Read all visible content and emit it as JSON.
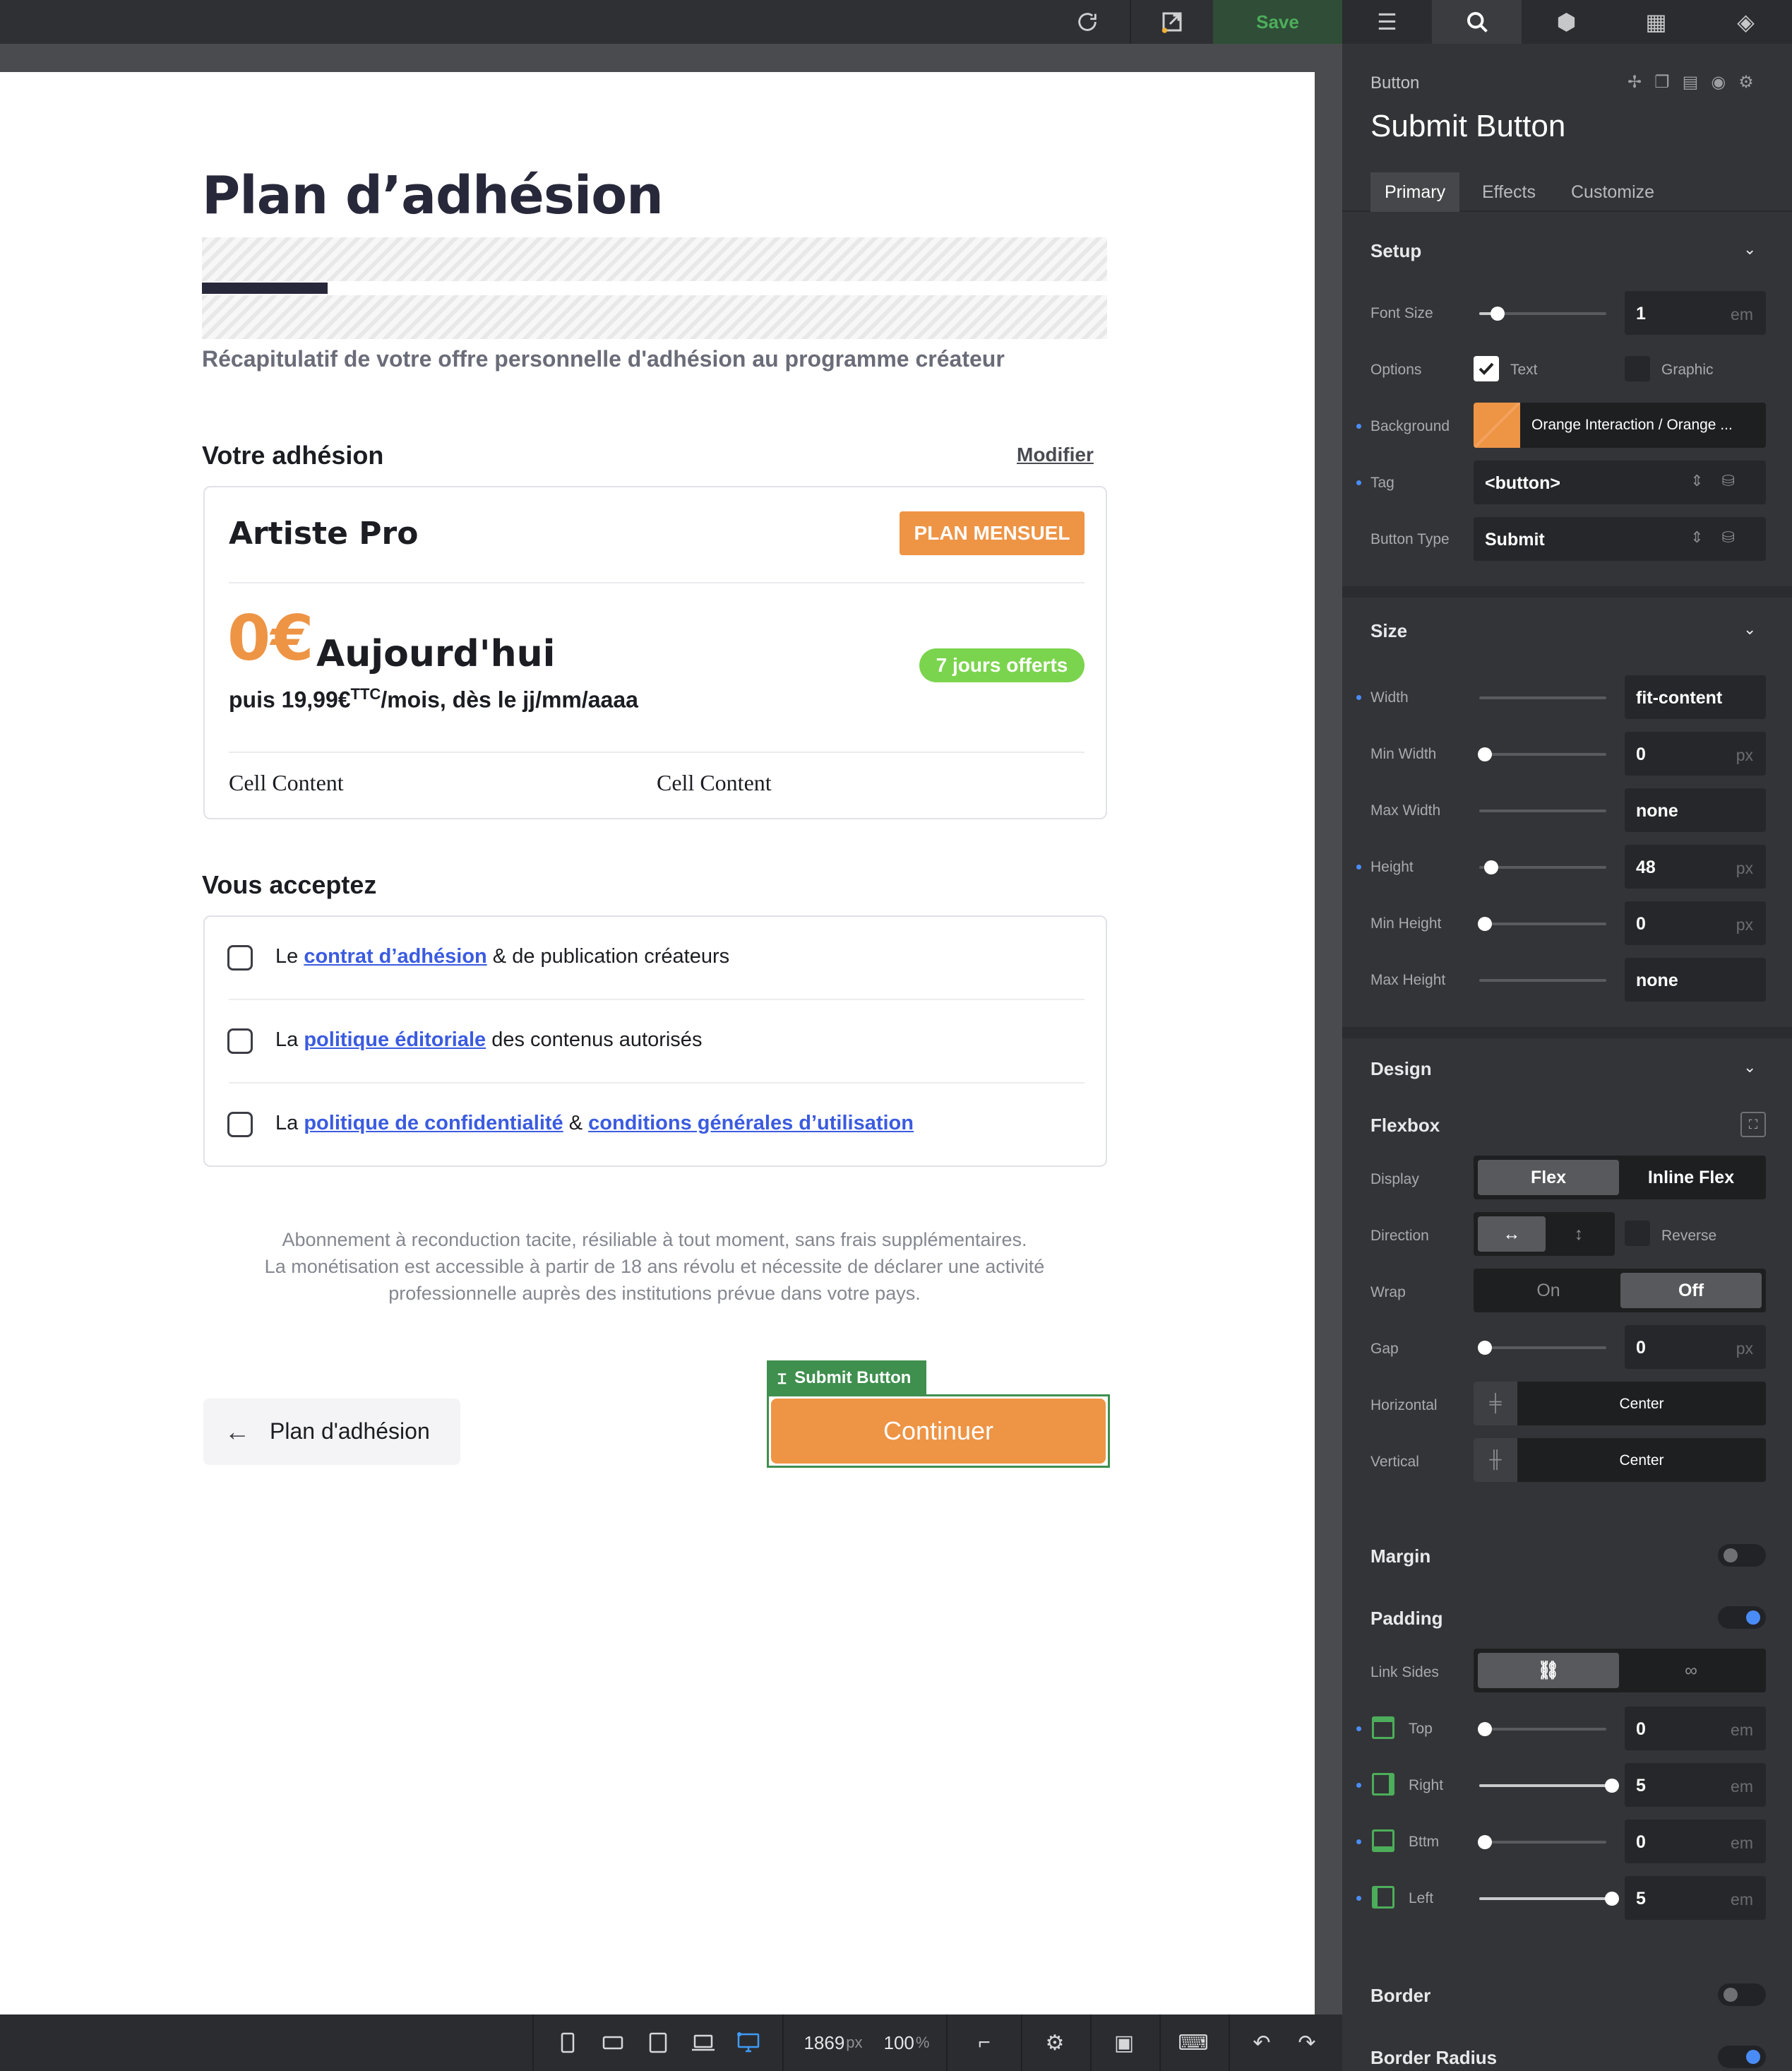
{
  "topbar": {
    "refresh_icon": "refresh-icon",
    "export_icon": "export-icon",
    "save_label": "Save"
  },
  "page": {
    "title": "Plan d’adhésion",
    "subtitle": "Récapitulatif de votre offre personnelle d'adhésion au programme créateur",
    "membership_heading": "Votre adhésion",
    "modify_link": "Modifier",
    "plan": {
      "name": "Artiste Pro",
      "badge": "PLAN MENSUEL",
      "price": "0€",
      "price_label": "Aujourd'hui",
      "price_sub_prefix": "puis 19,99€",
      "price_sub_sup": "TTC",
      "price_sub_suffix": "/mois, dès le jj/mm/aaaa",
      "offer_badge": "7 jours offerts",
      "cells": [
        "Cell Content",
        "Cell Content"
      ]
    },
    "accept_heading": "Vous acceptez",
    "terms": [
      {
        "pre": "Le ",
        "link1": "contrat d’adhésion",
        "mid": " & de publication créateurs",
        "link2": "",
        "post": ""
      },
      {
        "pre": "La ",
        "link1": "politique éditoriale",
        "mid": " des contenus autorisés",
        "link2": "",
        "post": ""
      },
      {
        "pre": "La ",
        "link1": "politique de confidentialité",
        "mid": " & ",
        "link2": "conditions générales d’utilisation",
        "post": ""
      }
    ],
    "legal": [
      "Abonnement à reconduction tacite, résiliable à tout moment, sans frais supplémentaires.",
      "La monétisation est accessible à partir de 18 ans révolu et nécessite de déclarer une activité",
      "professionnelle auprès des institutions prévue dans votre pays."
    ],
    "back_button": "Plan d'adhésion",
    "selection_tag": "Submit Button",
    "continue_button": "Continuer"
  },
  "bottombar": {
    "width_value": "1869",
    "width_unit": "px",
    "zoom_value": "100",
    "zoom_unit": "%"
  },
  "panel": {
    "element_type": "Button",
    "element_name": "Submit Button",
    "subtabs": [
      "Primary",
      "Effects",
      "Customize"
    ],
    "setup": {
      "heading": "Setup",
      "font_size_label": "Font Size",
      "font_size_value": "1",
      "font_size_unit": "em",
      "font_size_level": 0.1,
      "options_label": "Options",
      "option_text": "Text",
      "option_graphic": "Graphic",
      "option_text_checked": true,
      "option_graphic_checked": false,
      "background_label": "Background",
      "background_value": "Orange Interaction / Orange ...",
      "background_color": "#ee9445",
      "tag_label": "Tag",
      "tag_value": "<button>",
      "button_type_label": "Button Type",
      "button_type_value": "Submit"
    },
    "size": {
      "heading": "Size",
      "rows": [
        {
          "label": "Width",
          "value": "fit-content",
          "unit": "",
          "slider": false,
          "level": 0,
          "dot": true
        },
        {
          "label": "Min Width",
          "value": "0",
          "unit": "px",
          "slider": true,
          "level": 0,
          "dot": false
        },
        {
          "label": "Max Width",
          "value": "none",
          "unit": "",
          "slider": false,
          "level": 0,
          "dot": false
        },
        {
          "label": "Height",
          "value": "48",
          "unit": "px",
          "slider": true,
          "level": 0.05,
          "dot": true
        },
        {
          "label": "Min Height",
          "value": "0",
          "unit": "px",
          "slider": true,
          "level": 0,
          "dot": false
        },
        {
          "label": "Max Height",
          "value": "none",
          "unit": "",
          "slider": false,
          "level": 0,
          "dot": false
        }
      ]
    },
    "design": {
      "heading": "Design",
      "flexbox_heading": "Flexbox",
      "display_label": "Display",
      "display_options": [
        "Flex",
        "Inline Flex"
      ],
      "direction_label": "Direction",
      "reverse_label": "Reverse",
      "wrap_label": "Wrap",
      "wrap_options": [
        "On",
        "Off"
      ],
      "gap_label": "Gap",
      "gap_value": "0",
      "gap_unit": "px",
      "horizontal_label": "Horizontal",
      "horizontal_value": "Center",
      "vertical_label": "Vertical",
      "vertical_value": "Center",
      "margin_label": "Margin",
      "margin_on": false,
      "padding_label": "Padding",
      "padding_on": true,
      "link_sides_label": "Link Sides",
      "padding_rows": [
        {
          "label": "Top",
          "value": "0",
          "unit": "em",
          "level": 0
        },
        {
          "label": "Right",
          "value": "5",
          "unit": "em",
          "level": 1
        },
        {
          "label": "Bttm",
          "value": "0",
          "unit": "em",
          "level": 0
        },
        {
          "label": "Left",
          "value": "5",
          "unit": "em",
          "level": 1
        }
      ],
      "border_label": "Border",
      "border_on": false,
      "border_radius_label": "Border Radius",
      "border_radius_on": true
    }
  }
}
